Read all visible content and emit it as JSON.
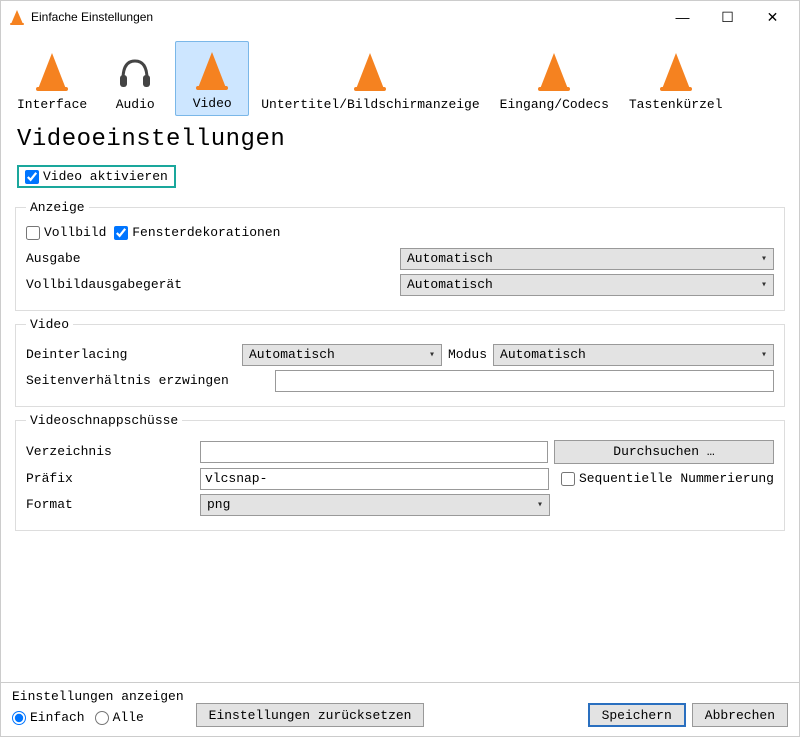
{
  "window": {
    "title": "Einfache Einstellungen"
  },
  "tabs": [
    {
      "label": "Interface"
    },
    {
      "label": "Audio"
    },
    {
      "label": "Video"
    },
    {
      "label": "Untertitel/Bildschirmanzeige"
    },
    {
      "label": "Eingang/Codecs"
    },
    {
      "label": "Tastenkürzel"
    }
  ],
  "page": {
    "title": "Videoeinstellungen"
  },
  "activate": {
    "label": "Video aktivieren",
    "checked": true
  },
  "display": {
    "legend": "Anzeige",
    "fullscreen": {
      "label": "Vollbild",
      "checked": false
    },
    "decorations": {
      "label": "Fensterdekorationen",
      "checked": true
    },
    "output": {
      "label": "Ausgabe",
      "value": "Automatisch"
    },
    "device": {
      "label": "Vollbildausgabegerät",
      "value": "Automatisch"
    }
  },
  "video": {
    "legend": "Video",
    "deinterlacing": {
      "label": "Deinterlacing",
      "value": "Automatisch"
    },
    "mode": {
      "label": "Modus",
      "value": "Automatisch"
    },
    "aspect": {
      "label": "Seitenverhältnis erzwingen",
      "value": ""
    }
  },
  "snap": {
    "legend": "Videoschnappschüsse",
    "dir": {
      "label": "Verzeichnis",
      "value": "",
      "browse": "Durchsuchen …"
    },
    "prefix": {
      "label": "Präfix",
      "value": "vlcsnap-",
      "seq_label": "Sequentielle Nummerierung",
      "seq_checked": false
    },
    "format": {
      "label": "Format",
      "value": "png"
    }
  },
  "footer": {
    "show_label": "Einstellungen anzeigen",
    "simple": "Einfach",
    "all": "Alle",
    "reset": "Einstellungen zurücksetzen",
    "save": "Speichern",
    "cancel": "Abbrechen"
  }
}
